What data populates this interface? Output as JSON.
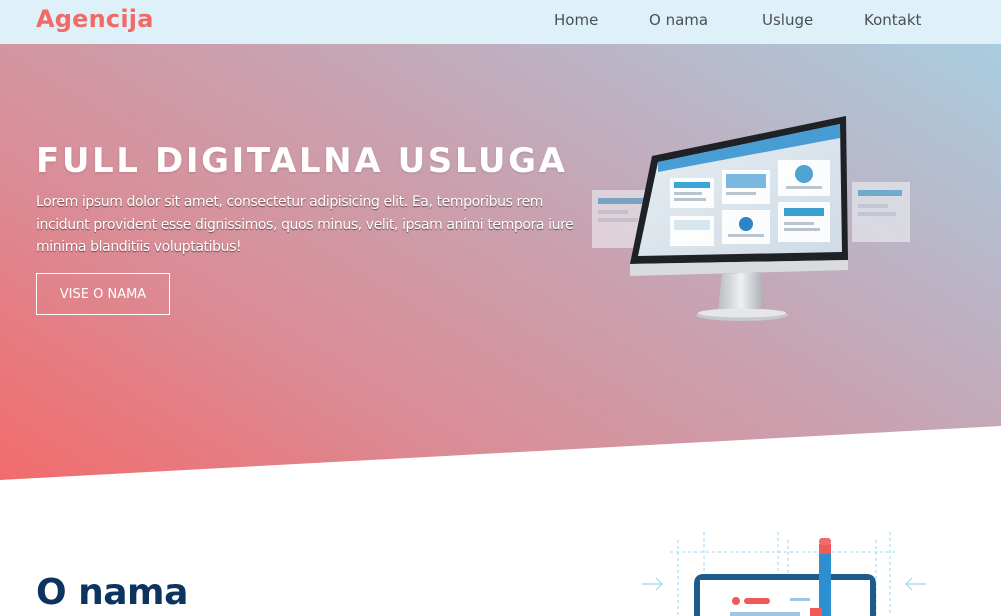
{
  "navbar": {
    "brand": "Agencija",
    "links": [
      {
        "label": "Home"
      },
      {
        "label": "O nama"
      },
      {
        "label": "Usluge"
      },
      {
        "label": "Kontakt"
      }
    ]
  },
  "hero": {
    "title": "FULL DIGITALNA USLUGA",
    "text": "Lorem ipsum dolor sit amet, consectetur adipisicing elit. Ea, temporibus rem incidunt provident esse dignissimos, quos minus, velit, ipsam animi tempora iure minima blanditiis voluptatibus!",
    "button_label": "VISE O NAMA",
    "image_icon": "desktop-monitor-with-websites"
  },
  "about": {
    "title": "O nama",
    "illustration_icon": "design-tools-illustration"
  },
  "colors": {
    "brand": "#f26a68",
    "nav_bg": "#dff1f8",
    "hero_gradient_start": "#f26b6c",
    "hero_gradient_end": "#a9cde0",
    "heading_dark": "#0d3460"
  }
}
